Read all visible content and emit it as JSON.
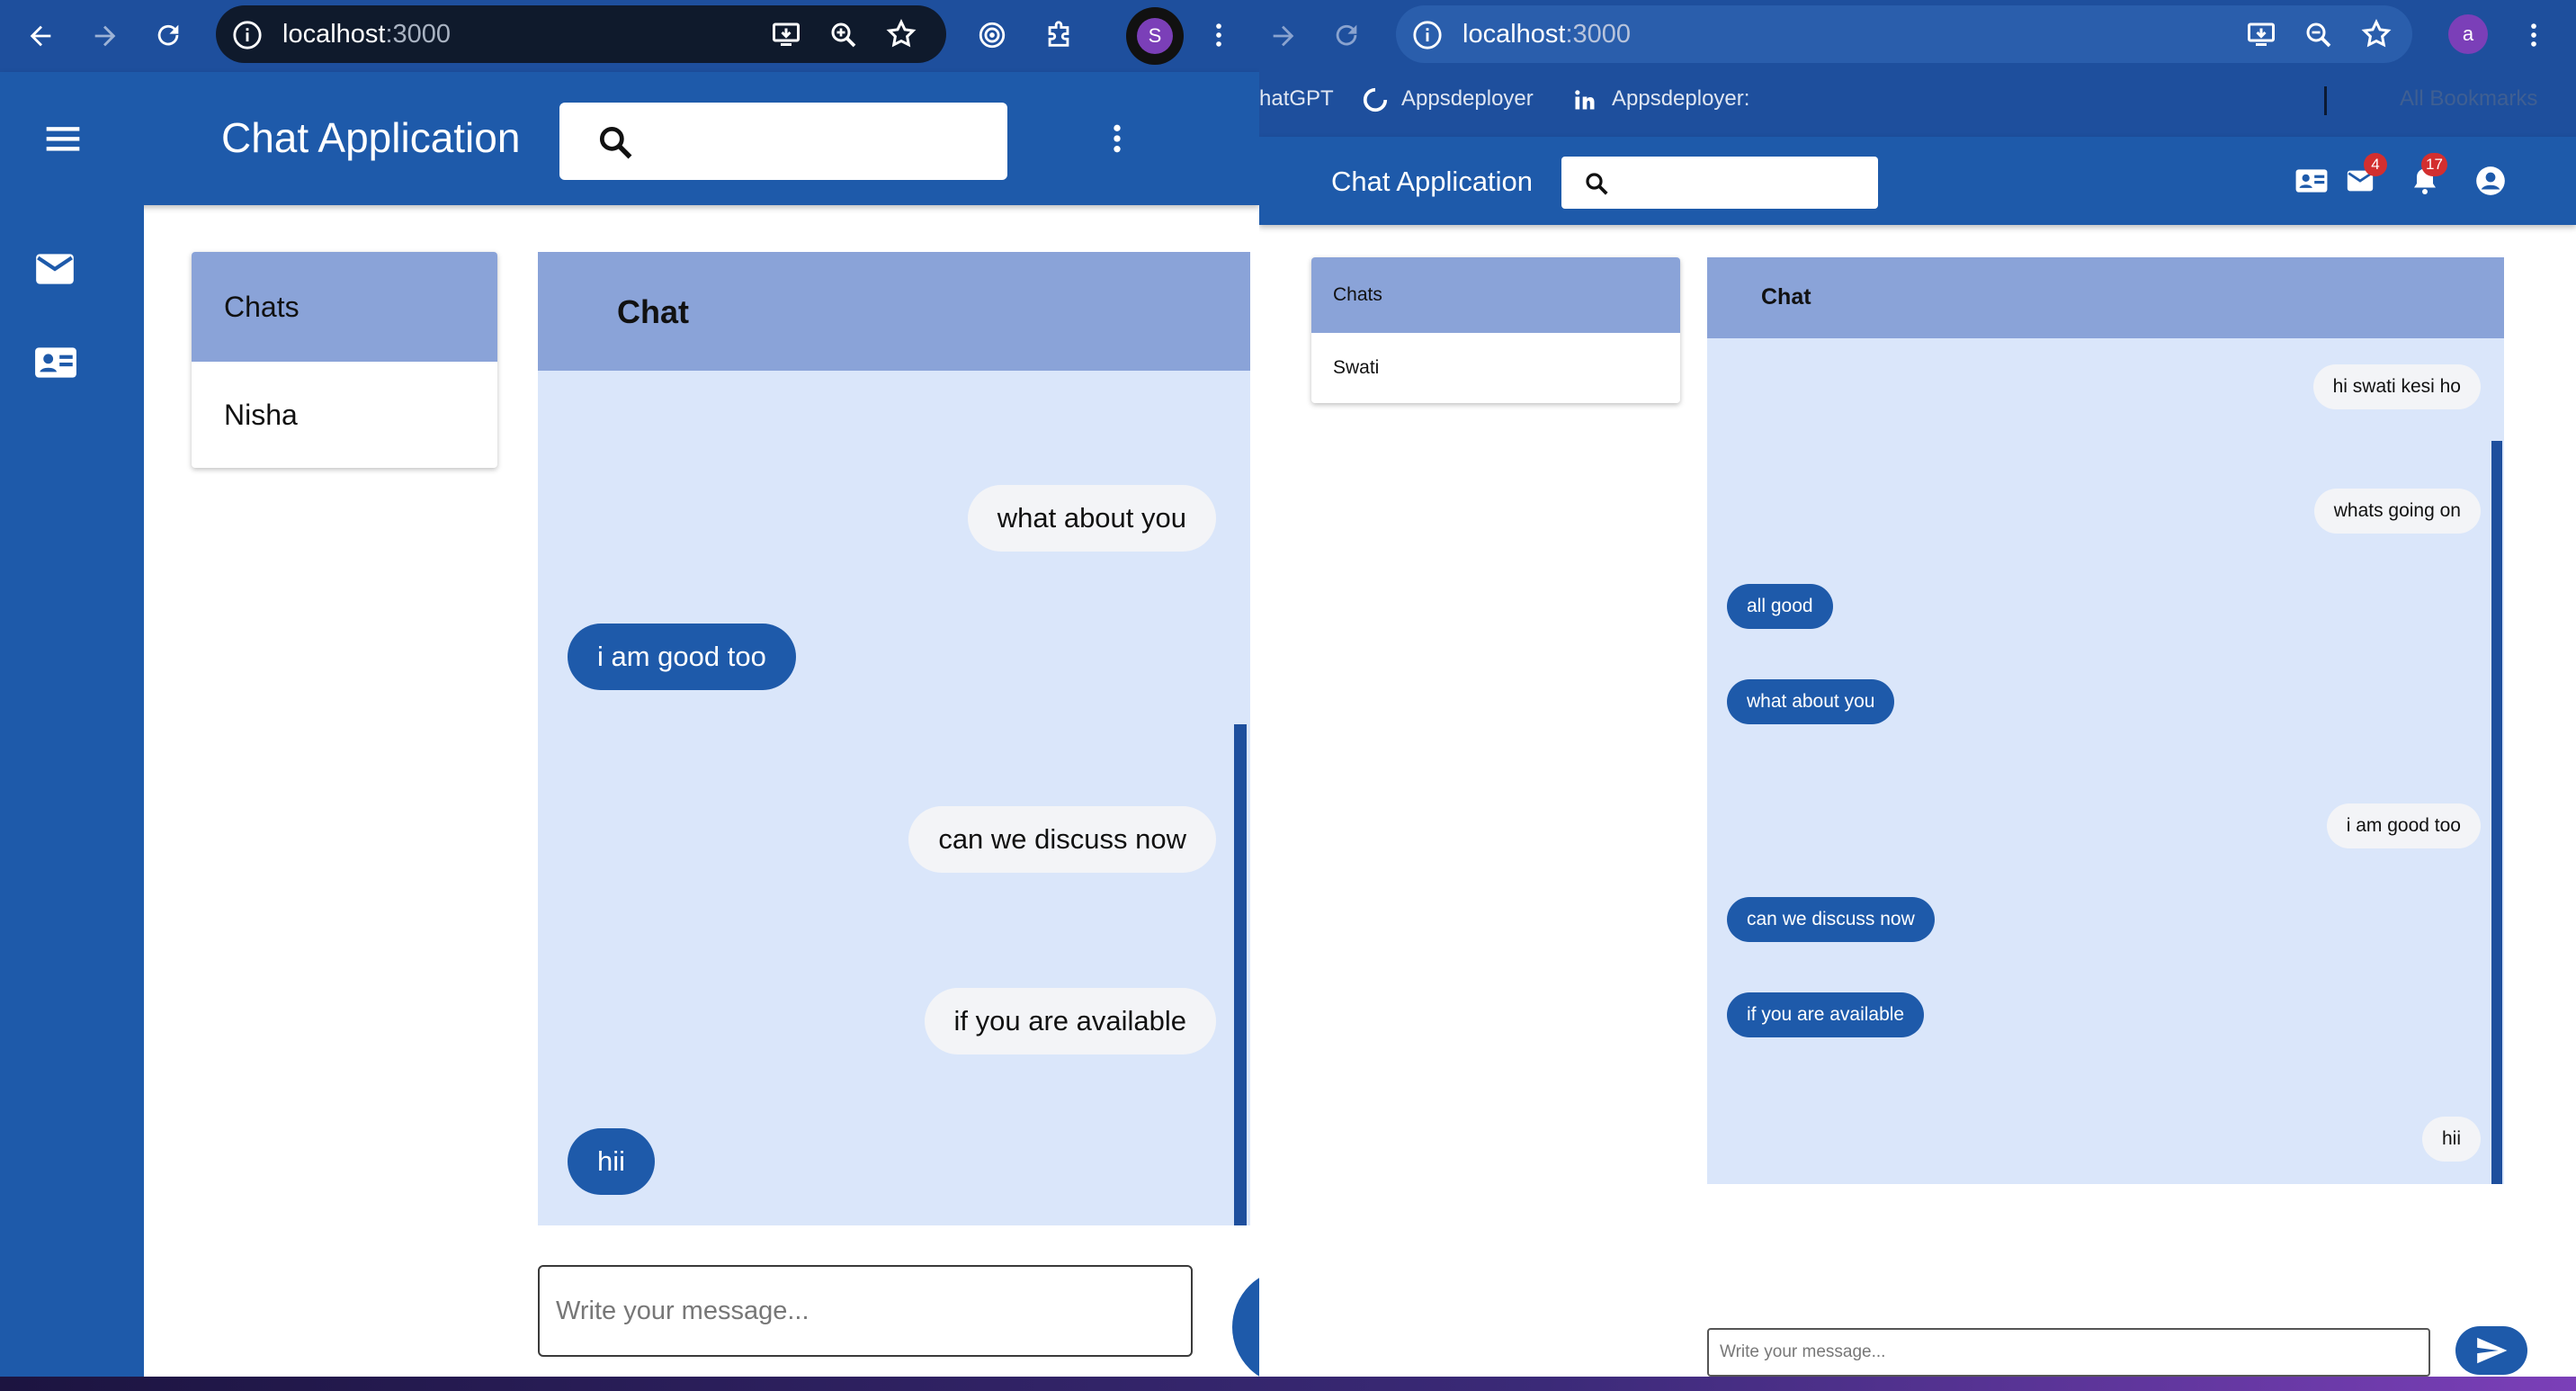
{
  "left_window": {
    "address_host": "localhost",
    "address_port": ":3000",
    "profile_initial": "S",
    "app_title": "Chat Application",
    "chats_header": "Chats",
    "chats_list": [
      "Nisha"
    ],
    "chat_title": "Chat",
    "messages": [
      {
        "text": "what about you",
        "side": "right"
      },
      {
        "text": "i am good too",
        "side": "left"
      },
      {
        "text": "can we discuss now",
        "side": "right"
      },
      {
        "text": "if you are available",
        "side": "right"
      },
      {
        "text": "hii",
        "side": "left"
      }
    ],
    "input_placeholder": "Write your message..."
  },
  "right_window": {
    "address_host": "localhost",
    "address_port": ":3000",
    "profile_initial": "a",
    "bookmarks": [
      "hatGPT",
      "Appsdeployer",
      "Appsdeployer:",
      "All Bookmarks"
    ],
    "app_title": "Chat Application",
    "mail_badge": "4",
    "notification_badge": "17",
    "chats_header": "Chats",
    "chats_list": [
      "Swati"
    ],
    "chat_title": "Chat",
    "messages": [
      {
        "text": "hi swati kesi ho",
        "side": "right"
      },
      {
        "text": "whats going on",
        "side": "right"
      },
      {
        "text": "all good",
        "side": "left"
      },
      {
        "text": "what about you",
        "side": "left"
      },
      {
        "text": "i am good too",
        "side": "right"
      },
      {
        "text": "can we discuss now",
        "side": "left"
      },
      {
        "text": "if you are available",
        "side": "left"
      },
      {
        "text": "hii",
        "side": "right"
      }
    ],
    "input_placeholder": "Write your message..."
  },
  "colors": {
    "primary": "#1e5aaa",
    "chrome": "#1e4f9d",
    "panel_header": "#8aa3d8",
    "chat_background": "#dae6fa",
    "incoming_bubble": "#f3f4f7",
    "badge": "#d32f2f"
  }
}
